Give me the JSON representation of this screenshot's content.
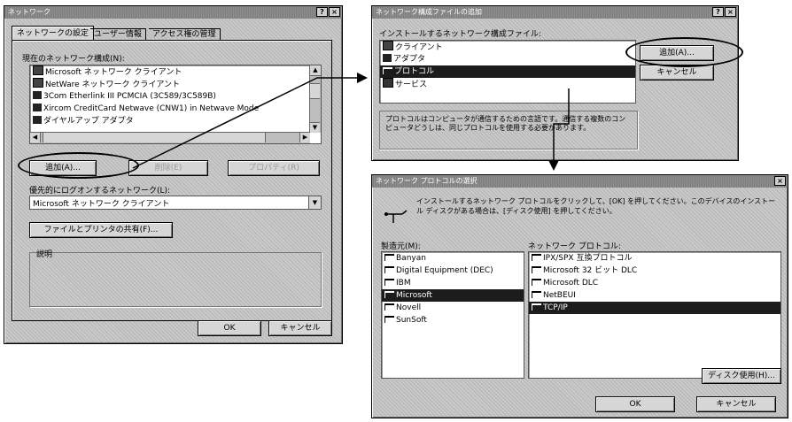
{
  "network_dialog": {
    "title": "ネットワーク",
    "help_btn": "?",
    "close_btn": "×",
    "tabs": [
      "ネットワークの設定",
      "ユーザー情報",
      "アクセス権の管理"
    ],
    "components_label": "現在のネットワーク構成(N):",
    "components": [
      "Microsoft ネットワーク クライアント",
      "NetWare ネットワーク クライアント",
      "3Com Etherlink III PCMCIA (3C589/3C589B)",
      "Xircom CreditCard Netwave (CNW1) in Netwave Mode",
      "ダイヤルアップ アダプタ"
    ],
    "add_button": "追加(A)...",
    "remove_button": "削除(E)",
    "properties_button": "プロパティ(R)",
    "logon_label": "優先的にログオンするネットワーク(L):",
    "logon_value": "Microsoft ネットワーク クライアント",
    "share_button": "ファイルとプリンタの共有(F)...",
    "description_label": "説明",
    "ok_button": "OK",
    "cancel_button": "キャンセル"
  },
  "select_type_dialog": {
    "title": "ネットワーク構成ファイルの追加",
    "help_btn": "?",
    "close_btn": "×",
    "list_label": "インストールするネットワーク構成ファイル:",
    "items": [
      "クライアント",
      "アダプタ",
      "プロトコル",
      "サービス"
    ],
    "selected_index": 2,
    "add_button": "追加(A)...",
    "cancel_button": "キャンセル",
    "description": "プロトコルはコンピュータが通信するための言語です。通信する複数のコンピュータどうしは、同じプロトコルを使用する必要があります。"
  },
  "select_protocol_dialog": {
    "title": "ネットワーク プロトコルの選択",
    "close_btn": "×",
    "instructions": "インストールするネットワーク プロトコルをクリックして、[OK] を押してください。このデバイスのインストール ディスクがある場合は、[ディスク使用] を押してください。",
    "manufacturers_label": "製造元(M):",
    "manufacturers": [
      "Banyan",
      "Digital Equipment (DEC)",
      "IBM",
      "Microsoft",
      "Novell",
      "SunSoft"
    ],
    "selected_manufacturer_index": 3,
    "protocols_label": "ネットワーク プロトコル:",
    "protocols": [
      "IPX/SPX 互換プロトコル",
      "Microsoft 32 ビット DLC",
      "Microsoft DLC",
      "NetBEUI",
      "TCP/IP"
    ],
    "selected_protocol_index": 4,
    "have_disk_button": "ディスク使用(H)...",
    "ok_button": "OK",
    "cancel_button": "キャンセル"
  },
  "colors": {
    "selection": "#1c1c1c",
    "dialog_bg": "#c9c9c9",
    "titlebar": "#7e7e7e"
  }
}
